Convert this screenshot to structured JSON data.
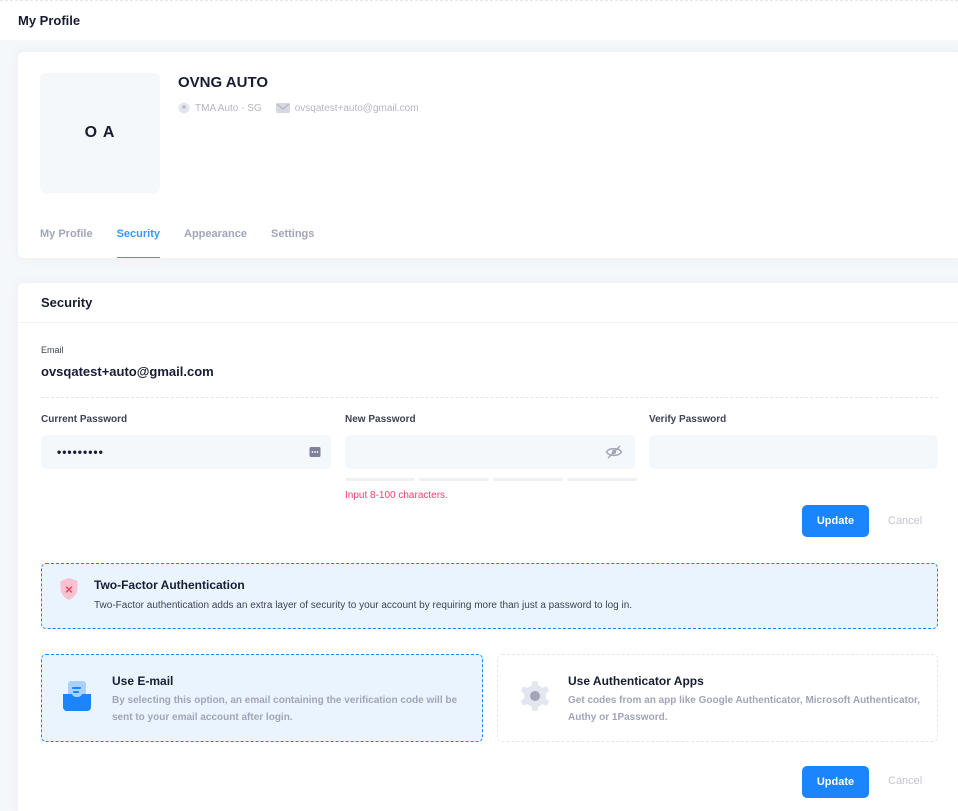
{
  "header": {
    "title": "My Profile"
  },
  "profile": {
    "initials": "O A",
    "name": "OVNG AUTO",
    "location": "TMA Auto - SG",
    "email": "ovsqatest+auto@gmail.com"
  },
  "tabs": [
    {
      "label": "My Profile",
      "active": false
    },
    {
      "label": "Security",
      "active": true
    },
    {
      "label": "Appearance",
      "active": false
    },
    {
      "label": "Settings",
      "active": false
    }
  ],
  "security": {
    "title": "Security",
    "email_label": "Email",
    "email_value": "ovsqatest+auto@gmail.com",
    "current_password_label": "Current Password",
    "current_password_value": "•••••••••",
    "new_password_label": "New Password",
    "new_password_value": "",
    "verify_password_label": "Verify Password",
    "verify_password_value": "",
    "hint": "Input 8-100 characters.",
    "update_label": "Update",
    "cancel_label": "Cancel"
  },
  "two_factor": {
    "title": "Two-Factor Authentication",
    "description": "Two-Factor authentication adds an extra layer of security to your account by requiring more than just a password to log in.",
    "options": [
      {
        "title": "Use E-mail",
        "description": "By selecting this option, an email containing the verification code will be sent to your email account after login.",
        "selected": true
      },
      {
        "title": "Use Authenticator Apps",
        "description": "Get codes from an app like Google Authenticator, Microsoft Authenticator, Authy or 1Password.",
        "selected": false
      }
    ],
    "update_label": "Update",
    "cancel_label": "Cancel"
  },
  "colors": {
    "primary": "#1b84ff",
    "danger": "#f1416c",
    "muted": "#a1a5b7"
  }
}
